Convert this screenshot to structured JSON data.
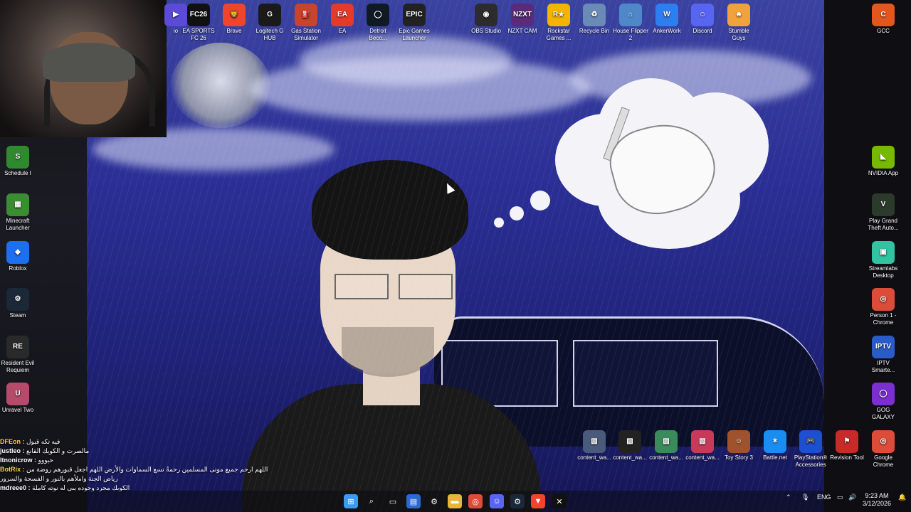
{
  "desktop_icons_top": [
    {
      "id": "studio",
      "label": "io",
      "color": "#5b4bd6",
      "glyph": "▶"
    },
    {
      "id": "fc26",
      "label": "EA SPORTS FC 26",
      "color": "#111111",
      "glyph": "FC26"
    },
    {
      "id": "brave",
      "label": "Brave",
      "color": "#f0452a",
      "glyph": "🦁"
    },
    {
      "id": "logitech",
      "label": "Logitech G HUB",
      "color": "#1a1a1a",
      "glyph": "G"
    },
    {
      "id": "gas",
      "label": "Gas Station Simulator",
      "color": "#c8452b",
      "glyph": "⛽"
    },
    {
      "id": "ea",
      "label": "EA",
      "color": "#e53a2a",
      "glyph": "EA"
    },
    {
      "id": "detroit",
      "label": "Detroit Beco...",
      "color": "#0f1a24",
      "glyph": "◯"
    },
    {
      "id": "epic",
      "label": "Epic Games Launcher",
      "color": "#222222",
      "glyph": "EPIC"
    },
    {
      "id": "obs",
      "label": "OBS Studio",
      "color": "#2c2c2c",
      "glyph": "◉"
    },
    {
      "id": "nzxt",
      "label": "NZXT CAM",
      "color": "#5a2b7a",
      "glyph": "NZXT"
    },
    {
      "id": "rockstar",
      "label": "Rockstar Games ...",
      "color": "#f4b400",
      "glyph": "R★"
    },
    {
      "id": "recycle",
      "label": "Recycle Bin",
      "color": "#6a8ab8",
      "glyph": "♻"
    },
    {
      "id": "house",
      "label": "House Flipper 2",
      "color": "#4f88c9",
      "glyph": "⌂"
    },
    {
      "id": "anker",
      "label": "AnkerWork",
      "color": "#2e7ef0",
      "glyph": "W"
    },
    {
      "id": "discord",
      "label": "Discord",
      "color": "#5865f2",
      "glyph": "☺"
    },
    {
      "id": "stumble",
      "label": "Stumble Guys",
      "color": "#f1a23a",
      "glyph": "☻"
    }
  ],
  "desktop_icons_left": [
    {
      "id": "schedule1",
      "label": "Schedule I",
      "color": "#2f8a2f",
      "glyph": "S"
    },
    {
      "id": "minecraft",
      "label": "Minecraft Launcher",
      "color": "#3b8d32",
      "glyph": "▦"
    },
    {
      "id": "roblox",
      "label": "Roblox",
      "color": "#1e6ef0",
      "glyph": "◆"
    },
    {
      "id": "steam",
      "label": "Steam",
      "color": "#1b2838",
      "glyph": "⚙"
    },
    {
      "id": "re",
      "label": "Resident Evil Requiem",
      "color": "#2a2a2a",
      "glyph": "RE"
    },
    {
      "id": "unravel",
      "label": "Unravel Two",
      "color": "#b64a6a",
      "glyph": "U"
    }
  ],
  "desktop_icons_right": [
    {
      "id": "gcc",
      "label": "GCC",
      "color": "#e2571e",
      "glyph": "C"
    },
    {
      "id": "nvidia",
      "label": "NVIDIA App",
      "color": "#76b900",
      "glyph": "◣"
    },
    {
      "id": "gta",
      "label": "Play Grand Theft Auto...",
      "color": "#2c3a2c",
      "glyph": "V"
    },
    {
      "id": "streamlabs",
      "label": "Streamlabs Desktop",
      "color": "#31c3a2",
      "glyph": "▣"
    },
    {
      "id": "chrome1",
      "label": "Person 1 - Chrome",
      "color": "#dd4b39",
      "glyph": "◎"
    },
    {
      "id": "iptv",
      "label": "IPTV Smarte...",
      "color": "#2a5cc9",
      "glyph": "IPTV"
    },
    {
      "id": "gog",
      "label": "GOG GALAXY",
      "color": "#7b2fd1",
      "glyph": "◯"
    },
    {
      "id": "chrome2",
      "label": "Google Chrome",
      "color": "#dd4b39",
      "glyph": "◎"
    }
  ],
  "desktop_icons_bottom": [
    {
      "id": "cw1",
      "label": "content_wa...",
      "color": "#4a5a7a",
      "glyph": "▧"
    },
    {
      "id": "cw2",
      "label": "content_wa...",
      "color": "#222222",
      "glyph": "▧"
    },
    {
      "id": "cw3",
      "label": "content_wa...",
      "color": "#3a8a5a",
      "glyph": "▧"
    },
    {
      "id": "cw4",
      "label": "content_wa...",
      "color": "#c83a5a",
      "glyph": "▧"
    },
    {
      "id": "toystory",
      "label": "Toy Story 3",
      "color": "#a0522d",
      "glyph": "☺"
    },
    {
      "id": "battlenet",
      "label": "Battle.net",
      "color": "#1a8ef0",
      "glyph": "✶"
    },
    {
      "id": "ps",
      "label": "PlayStation® Accessories",
      "color": "#1f4fd1",
      "glyph": "🎮"
    },
    {
      "id": "revision",
      "label": "Revision Tool",
      "color": "#c82a2a",
      "glyph": "⚑"
    }
  ],
  "chat": [
    {
      "user": "DFEon :",
      "text": "فيه تكه قبول",
      "user_color": "#ffd23a"
    },
    {
      "user": "justleo :",
      "text": "مالصرت و الكويك القانع",
      "user_color": "#ffffff"
    },
    {
      "user": "Itnonicrow :",
      "text": "حيووو",
      "user_color": "#ffffff"
    },
    {
      "user": "BotRix :",
      "text": "اللهم ارحم جميع موتى المسلمين رحمةً تسع السماوات والأرض اللهم اجعل قبورهم روضة من",
      "user_color": "#ffd23a"
    },
    {
      "user": "",
      "text": "رياض الجنة واملأهم بالنور و الفسحة والسرور",
      "user_color": "#ffffff"
    },
    {
      "user": "mdreee0 :",
      "text": "الكويك مجرد وجوده يبي له نوته كاملة",
      "user_color": "#ffffff"
    }
  ],
  "taskbar": {
    "pinned": [
      {
        "id": "start",
        "glyph": "⊞",
        "color": "#3a9bf0"
      },
      {
        "id": "search",
        "glyph": "⌕",
        "color": "transparent"
      },
      {
        "id": "taskview",
        "glyph": "▭",
        "color": "transparent"
      },
      {
        "id": "store",
        "glyph": "▤",
        "color": "#2a6ad1"
      },
      {
        "id": "settings",
        "glyph": "⚙",
        "color": "transparent"
      },
      {
        "id": "explorer",
        "glyph": "▬",
        "color": "#e8b43a"
      },
      {
        "id": "chrome",
        "glyph": "◎",
        "color": "#dd4b39"
      },
      {
        "id": "discord",
        "glyph": "☺",
        "color": "#5865f2"
      },
      {
        "id": "steam",
        "glyph": "⚙",
        "color": "#1b2838"
      },
      {
        "id": "brave",
        "glyph": "▼",
        "color": "#f0452a"
      },
      {
        "id": "capcut",
        "glyph": "✕",
        "color": "#111111"
      }
    ],
    "tray": {
      "lang": "ENG",
      "time": "9:23 AM",
      "date": "3/12/2026"
    }
  }
}
